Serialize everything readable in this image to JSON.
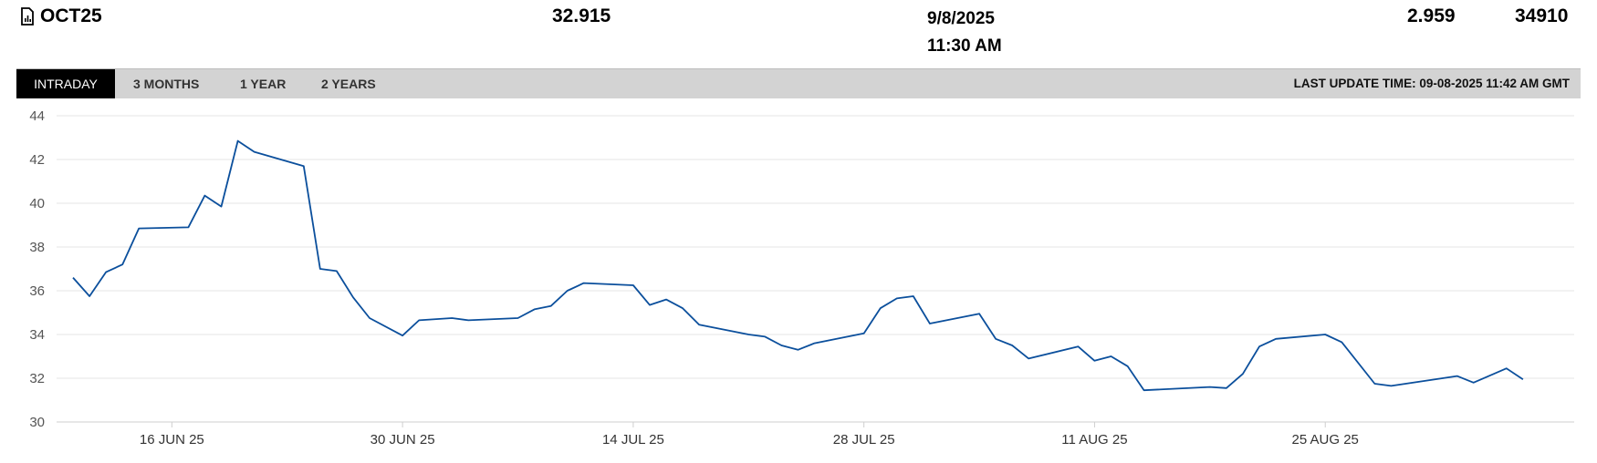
{
  "header": {
    "contract": "OCT25",
    "contract_icon": "chart-document-icon",
    "price": "32.915",
    "date": "9/8/2025",
    "time": "11:30 AM",
    "change": "2.959",
    "volume": "34910"
  },
  "tabs": [
    {
      "label": "INTRADAY",
      "active": true
    },
    {
      "label": "3 MONTHS",
      "active": false
    },
    {
      "label": "1 YEAR",
      "active": false
    },
    {
      "label": "2 YEARS",
      "active": false
    }
  ],
  "last_update": "LAST UPDATE TIME: 09-08-2025 11:42 AM GMT",
  "colors": {
    "line": "#0b4f9c",
    "grid": "#e6e6e6",
    "tabbar": "#d3d3d3",
    "active_tab": "#000000"
  },
  "chart_data": {
    "type": "line",
    "title": "",
    "xlabel": "",
    "ylabel": "",
    "ylim": [
      30,
      44
    ],
    "xlim": [
      "2025-06-10",
      "2025-09-08"
    ],
    "y_ticks": [
      "30",
      "32",
      "34",
      "36",
      "38",
      "40",
      "42",
      "44"
    ],
    "x_ticks": [
      {
        "label": "16 JUN 25",
        "date": "2025-06-16"
      },
      {
        "label": "30 JUN 25",
        "date": "2025-06-30"
      },
      {
        "label": "14 JUL 25",
        "date": "2025-07-14"
      },
      {
        "label": "28 JUL 25",
        "date": "2025-07-28"
      },
      {
        "label": "11 AUG 25",
        "date": "2025-08-11"
      },
      {
        "label": "25 AUG 25",
        "date": "2025-08-25"
      }
    ],
    "grid": true,
    "series": [
      {
        "points": [
          [
            "2025-06-10",
            36.6
          ],
          [
            "2025-06-11",
            35.75
          ],
          [
            "2025-06-12",
            36.85
          ],
          [
            "2025-06-13",
            37.2
          ],
          [
            "2025-06-14",
            38.85
          ],
          [
            "2025-06-17",
            38.9
          ],
          [
            "2025-06-18",
            40.35
          ],
          [
            "2025-06-19",
            39.85
          ],
          [
            "2025-06-20",
            42.85
          ],
          [
            "2025-06-21",
            42.35
          ],
          [
            "2025-06-24",
            41.7
          ],
          [
            "2025-06-25",
            37.0
          ],
          [
            "2025-06-26",
            36.9
          ],
          [
            "2025-06-27",
            35.7
          ],
          [
            "2025-06-28",
            34.75
          ],
          [
            "2025-06-30",
            33.95
          ],
          [
            "2025-07-01",
            34.65
          ],
          [
            "2025-07-03",
            34.75
          ],
          [
            "2025-07-04",
            34.65
          ],
          [
            "2025-07-07",
            34.75
          ],
          [
            "2025-07-08",
            35.15
          ],
          [
            "2025-07-09",
            35.3
          ],
          [
            "2025-07-10",
            36.0
          ],
          [
            "2025-07-11",
            36.35
          ],
          [
            "2025-07-14",
            36.25
          ],
          [
            "2025-07-15",
            35.35
          ],
          [
            "2025-07-16",
            35.6
          ],
          [
            "2025-07-17",
            35.2
          ],
          [
            "2025-07-18",
            34.45
          ],
          [
            "2025-07-21",
            34.0
          ],
          [
            "2025-07-22",
            33.9
          ],
          [
            "2025-07-23",
            33.5
          ],
          [
            "2025-07-24",
            33.3
          ],
          [
            "2025-07-25",
            33.6
          ],
          [
            "2025-07-28",
            34.05
          ],
          [
            "2025-07-29",
            35.2
          ],
          [
            "2025-07-30",
            35.65
          ],
          [
            "2025-07-31",
            35.75
          ],
          [
            "2025-08-01",
            34.5
          ],
          [
            "2025-08-04",
            34.95
          ],
          [
            "2025-08-05",
            33.8
          ],
          [
            "2025-08-06",
            33.5
          ],
          [
            "2025-08-07",
            32.9
          ],
          [
            "2025-08-10",
            33.45
          ],
          [
            "2025-08-11",
            32.8
          ],
          [
            "2025-08-12",
            33.0
          ],
          [
            "2025-08-13",
            32.55
          ],
          [
            "2025-08-14",
            31.45
          ],
          [
            "2025-08-18",
            31.6
          ],
          [
            "2025-08-19",
            31.55
          ],
          [
            "2025-08-20",
            32.2
          ],
          [
            "2025-08-21",
            33.45
          ],
          [
            "2025-08-22",
            33.8
          ],
          [
            "2025-08-25",
            34.0
          ],
          [
            "2025-08-26",
            33.65
          ],
          [
            "2025-08-28",
            31.75
          ],
          [
            "2025-08-29",
            31.65
          ],
          [
            "2025-09-02",
            32.1
          ],
          [
            "2025-09-03",
            31.8
          ],
          [
            "2025-09-05",
            32.45
          ],
          [
            "2025-09-06",
            31.95
          ]
        ]
      }
    ]
  }
}
